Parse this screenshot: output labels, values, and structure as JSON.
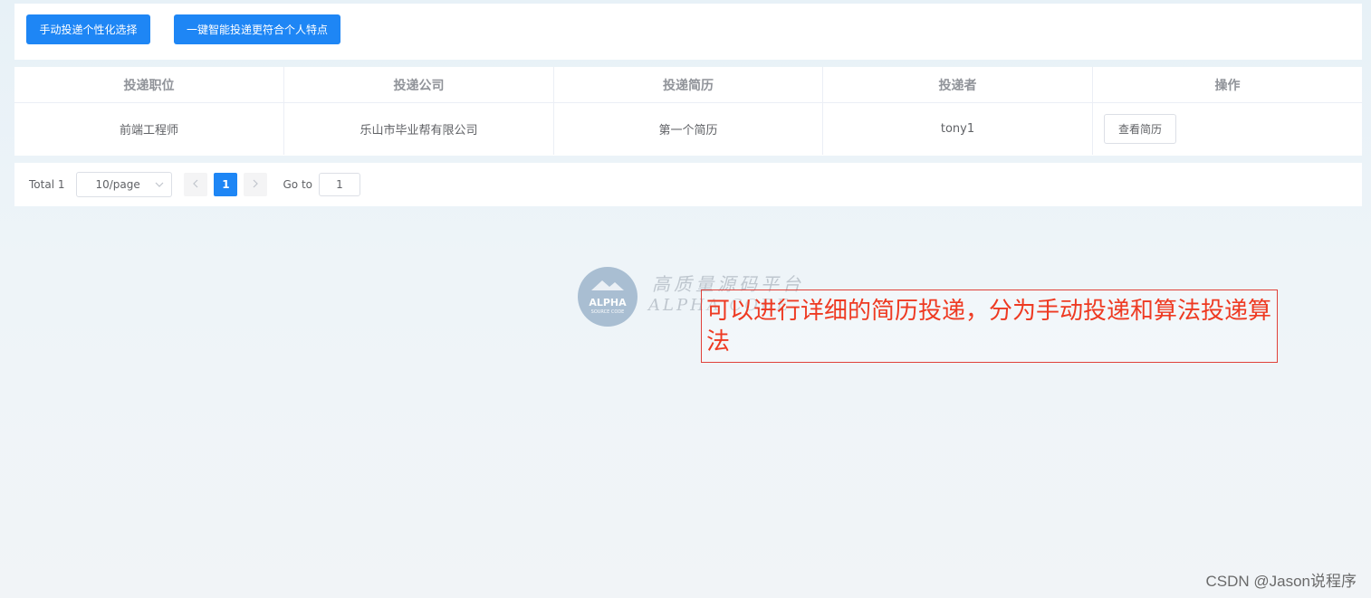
{
  "toolbar": {
    "manual_button": "手动投递个性化选择",
    "smart_button": "一键智能投递更符合个人特点"
  },
  "table": {
    "headers": [
      "投递职位",
      "投递公司",
      "投递简历",
      "投递者",
      "操作"
    ],
    "rows": [
      {
        "position": "前端工程师",
        "company": "乐山市毕业帮有限公司",
        "resume": "第一个简历",
        "applicant": "tony1",
        "action": "查看简历"
      }
    ]
  },
  "pagination": {
    "total": "Total 1",
    "page_size": "10/page",
    "current_page": "1",
    "goto_label": "Go to",
    "goto_value": "1",
    "prev_icon": "chevron-left-icon",
    "next_icon": "chevron-right-icon"
  },
  "watermark": {
    "logo_text": "ALPHA",
    "logo_subtext": "SOURCE CODE",
    "line1": "高质量源码平台",
    "line2": "ALPHA CODE"
  },
  "annotation": {
    "text": "可以进行详细的简历投递，分为手动投递和算法投递算法"
  },
  "footer": {
    "credit": "CSDN @Jason说程序"
  },
  "colors": {
    "primary": "#1e86f5",
    "annotation_red": "#ee3a22",
    "border": "#ebeef5"
  }
}
